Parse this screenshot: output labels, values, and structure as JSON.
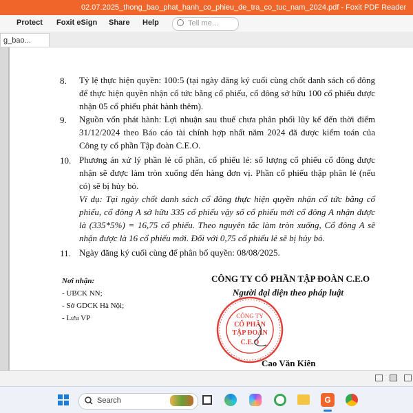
{
  "window": {
    "title": "02.07.2025_thong_bao_phat_hanh_co_phieu_de_tra_co_tuc_nam_2024.pdf - Foxit PDF Reader"
  },
  "ribbon": {
    "menus": [
      "Protect",
      "Foxit eSign",
      "Share",
      "Help"
    ],
    "search_placeholder": "Tell me..."
  },
  "tab": {
    "label": "g_bao..."
  },
  "document": {
    "items": [
      {
        "num": "8.",
        "text": "Tỷ lệ thực hiện quyền: 100:5 (tại ngày đăng ký cuối cùng chốt danh sách cổ đông để thực hiện quyền nhận cổ tức bằng cổ phiếu, cổ đông sở hữu 100 cổ phiếu được nhận 05 cổ phiếu phát hành thêm)."
      },
      {
        "num": "9.",
        "text": "Nguồn vốn phát hành: Lợi nhuận sau thuế chưa phân phối lũy kế đến thời điểm 31/12/2024 theo Báo cáo tài chính hợp nhất năm 2024 đã được kiểm toán của Công ty cổ phần Tập đoàn C.E.O."
      },
      {
        "num": "10.",
        "text": "Phương án xử lý phần lẻ cổ phần, cổ phiếu lẻ: số lượng cổ phiếu cổ đông được nhận sẽ được làm tròn xuống đến hàng đơn vị. Phần cổ phiếu thập phân lẻ (nếu có) sẽ bị hủy bỏ.",
        "example": "Ví dụ: Tại ngày chốt danh sách cổ đông thực hiện quyền nhận cổ tức bằng cổ phiếu, cổ đông A sở hữu 335 cổ phiếu vậy số cổ phiếu mới cổ đông A nhận được là (335*5%) = 16,75 cổ phiếu. Theo nguyên tắc làm tròn xuống, Cổ đông A sẽ nhận được là 16 cổ phiếu mới. Đối với 0,75 cổ phiếu lẻ sẽ bị hủy bỏ."
      },
      {
        "num": "11.",
        "text": "Ngày đăng ký cuối cùng để phân bổ quyền: 08/08/2025."
      }
    ],
    "recipients": {
      "heading": "Nơi nhận:",
      "lines": [
        "- UBCK NN;",
        "- Sở GDCK Hà Nội;",
        "- Lưu VP"
      ]
    },
    "signature": {
      "company": "CÔNG TY CỔ PHẦN TẬP ĐOÀN C.E.O",
      "role": "Người đại diện theo pháp luật",
      "name": "Cao Văn Kiên",
      "seal_lines": [
        "CÔNG TY",
        "CỔ PHẦN",
        "TẬP ĐOÀN",
        "C.E.O"
      ]
    }
  },
  "taskbar": {
    "search_label": "Search"
  },
  "colors": {
    "titlebar": "#f0662a",
    "seal": "#e0403a"
  }
}
